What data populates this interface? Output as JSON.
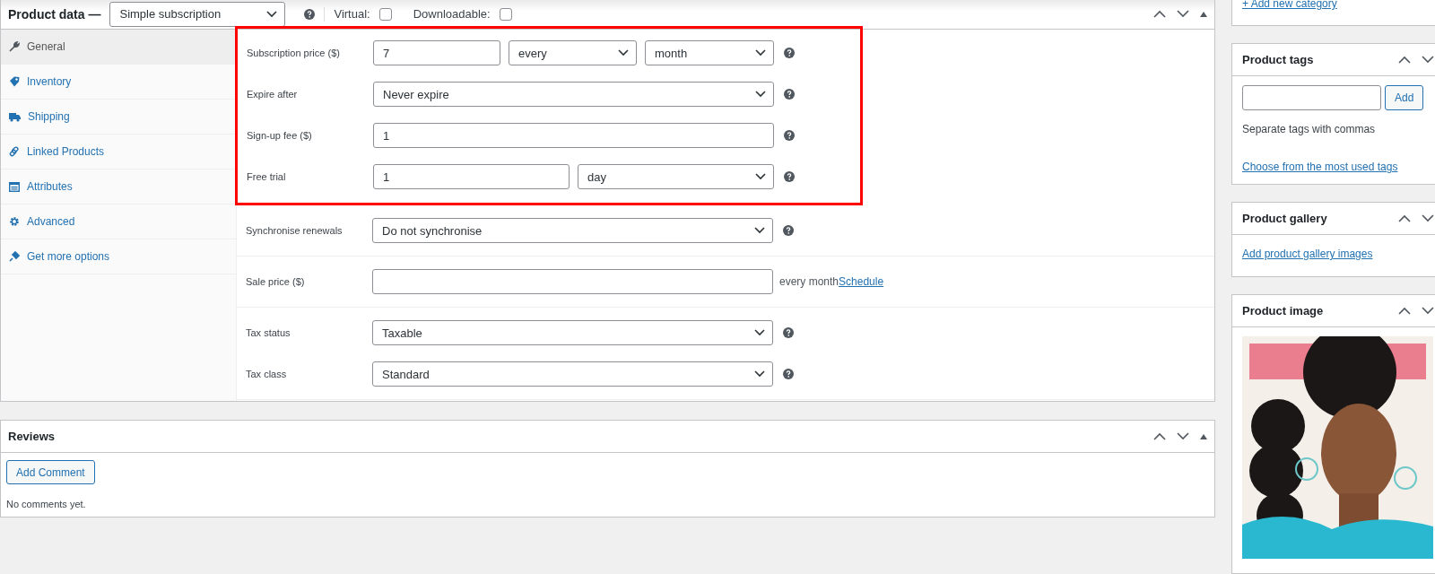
{
  "product_data": {
    "title": "Product data —",
    "type_select": "Simple subscription",
    "virtual": {
      "label": "Virtual:",
      "checked": false
    },
    "downloadable": {
      "label": "Downloadable:",
      "checked": false
    }
  },
  "tabs": [
    {
      "label": "General",
      "selected": true
    },
    {
      "label": "Inventory",
      "selected": false
    },
    {
      "label": "Shipping",
      "selected": false
    },
    {
      "label": "Linked Products",
      "selected": false
    },
    {
      "label": "Attributes",
      "selected": false
    },
    {
      "label": "Advanced",
      "selected": false
    },
    {
      "label": "Get more options",
      "selected": false
    }
  ],
  "form_groups": [
    {
      "highlighted": true,
      "fields": [
        {
          "kind": "price",
          "label": "Subscription price ($)",
          "value": "7",
          "interval": "every",
          "period": "month"
        },
        {
          "kind": "select",
          "label": "Expire after",
          "value": "Never expire"
        },
        {
          "kind": "text",
          "label": "Sign-up fee ($)",
          "value": "1"
        },
        {
          "kind": "trial",
          "label": "Free trial",
          "value": "1",
          "unit": "day"
        }
      ]
    },
    {
      "highlighted": false,
      "fields": [
        {
          "kind": "select",
          "label": "Synchronise renewals",
          "value": "Do not synchronise"
        }
      ]
    },
    {
      "highlighted": false,
      "fields": [
        {
          "kind": "sale",
          "label": "Sale price ($)",
          "suffix": "every month",
          "link": "Schedule"
        }
      ]
    },
    {
      "highlighted": false,
      "fields": [
        {
          "kind": "select",
          "label": "Tax status",
          "value": "Taxable"
        },
        {
          "kind": "select",
          "label": "Tax class",
          "value": "Standard"
        }
      ]
    }
  ],
  "reviews": {
    "title": "Reviews",
    "button": "Add Comment",
    "empty": "No comments yet."
  },
  "sidebar": {
    "category_link": "+ Add new category",
    "tags": {
      "title": "Product tags",
      "button": "Add",
      "hint": "Separate tags with commas",
      "link": "Choose from the most used tags"
    },
    "gallery": {
      "title": "Product gallery",
      "link": "Add product gallery images"
    },
    "image": {
      "title": "Product image",
      "kind": "picture"
    }
  }
}
